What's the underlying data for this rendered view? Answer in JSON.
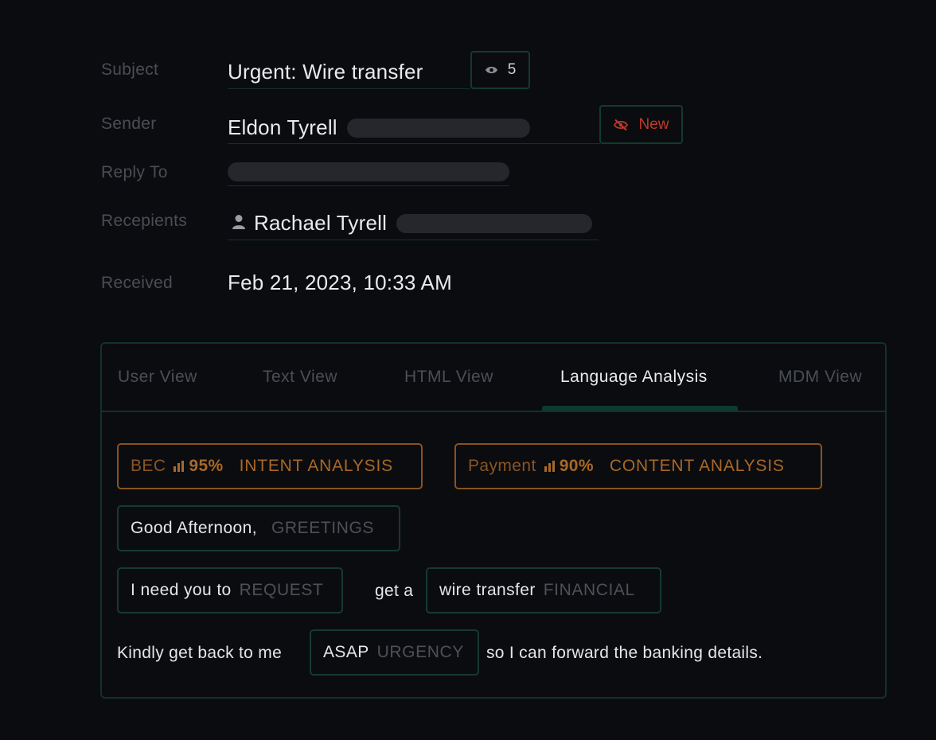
{
  "header": {
    "subject_label": "Subject",
    "subject_value": "Urgent: Wire transfer",
    "views_count": "5",
    "views_icon": "eye-icon",
    "sender_label": "Sender",
    "sender_name": "Eldon Tyrell",
    "new_badge_label": "New",
    "new_badge_icon": "eye-slash-icon",
    "reply_to_label": "Reply To",
    "recipients_label": "Recepients",
    "recipient_icon": "user-icon",
    "recipient_name": "Rachael Tyrell",
    "received_label": "Received",
    "received_value": "Feb 21, 2023, 10:33 AM"
  },
  "tabs": [
    {
      "label": "User View"
    },
    {
      "label": "Text View"
    },
    {
      "label": "HTML View"
    },
    {
      "label": "Language Analysis"
    },
    {
      "label": "MDM View"
    }
  ],
  "active_tab": "Language Analysis",
  "analysis": {
    "intent": {
      "name": "BEC",
      "score": "95%",
      "category": "INTENT ANALYSIS"
    },
    "content": {
      "name": "Payment",
      "score": "90%",
      "category": "CONTENT ANALYSIS"
    },
    "greeting": {
      "text": "Good Afternoon,",
      "category": "GREETINGS"
    },
    "request": {
      "text": "I need you to",
      "category": "REQUEST"
    },
    "connector": "get a",
    "financial": {
      "text": "wire transfer",
      "category": "FINANCIAL"
    },
    "urgency_prefix": "Kindly get back to me",
    "urgency": {
      "text": "ASAP",
      "category": "URGENCY"
    },
    "urgency_suffix": "so I can forward the banking details."
  },
  "colors": {
    "background": "#0b0c10",
    "border_green": "#123228",
    "accent_orange": "#a86827",
    "alert_red": "#c0392b"
  }
}
